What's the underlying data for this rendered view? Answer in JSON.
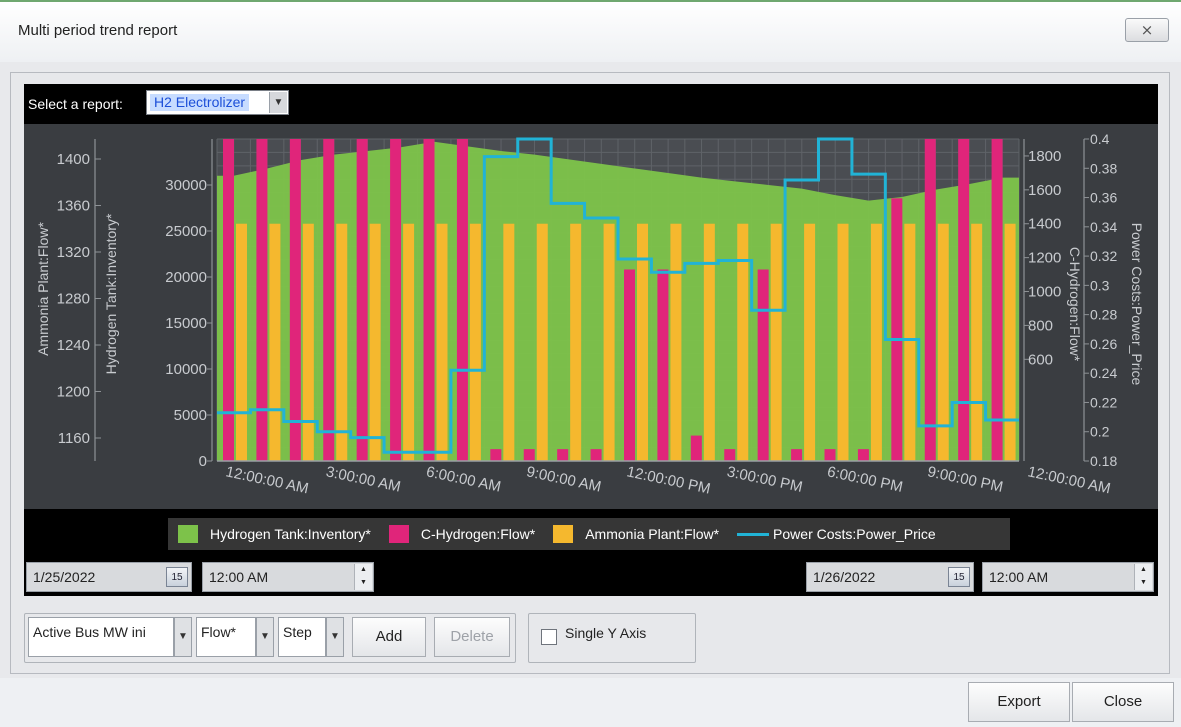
{
  "window": {
    "title": "Multi period trend report",
    "close_label": "⨯"
  },
  "report": {
    "select_label": "Select a report:",
    "selected": "H2 Electrolizer"
  },
  "chart_data": {
    "type": "bar",
    "x_ticks": [
      "12:00:00 AM",
      "3:00:00 AM",
      "6:00:00 AM",
      "9:00:00 AM",
      "12:00:00 PM",
      "3:00:00 PM",
      "6:00:00 PM",
      "9:00:00 PM",
      "12:00:00 AM"
    ],
    "slots": 24,
    "axes": {
      "ammonia": {
        "label": "Ammonia Plant:Flow*",
        "ticks": [
          1160,
          1200,
          1240,
          1280,
          1320,
          1360,
          1400
        ]
      },
      "hydrogen_tank": {
        "label": "Hydrogen Tank:Inventory*",
        "range": [
          0,
          35000
        ],
        "ticks": [
          0,
          5000,
          10000,
          15000,
          20000,
          25000,
          30000
        ]
      },
      "c_hydrogen": {
        "label": "C-Hydrogen:Flow*",
        "range": [
          0,
          1900
        ],
        "ticks": [
          600,
          800,
          1000,
          1200,
          1400,
          1600,
          1800
        ]
      },
      "power": {
        "label": "Power Costs:Power_Price",
        "range": [
          0.18,
          0.4
        ],
        "ticks": [
          0.18,
          0.2,
          0.22,
          0.24,
          0.26,
          0.28,
          0.3,
          0.32,
          0.34,
          0.36,
          0.38,
          0.4
        ]
      }
    },
    "series": [
      {
        "name": "Hydrogen Tank:Inventory*",
        "type": "area",
        "color": "#7dc24a",
        "values": [
          31000,
          31800,
          32700,
          33300,
          33700,
          34100,
          34700,
          34200,
          33700,
          33300,
          32800,
          32300,
          31800,
          31300,
          30800,
          30400,
          30000,
          29600,
          28900,
          28300,
          28700,
          29500,
          30100,
          30800
        ]
      },
      {
        "name": "C-Hydrogen:Flow*",
        "type": "bar",
        "color": "#e0257a",
        "values": [
          1900,
          1900,
          1900,
          1900,
          1900,
          1900,
          1900,
          1900,
          70,
          70,
          70,
          70,
          1130,
          1130,
          150,
          70,
          1130,
          70,
          70,
          70,
          1550,
          1900,
          1900,
          1900
        ]
      },
      {
        "name": "Ammonia Plant:Flow*",
        "type": "bar",
        "color": "#f5b82e",
        "values": [
          1400,
          1400,
          1400,
          1400,
          1400,
          1400,
          1400,
          1400,
          1400,
          1400,
          1400,
          1400,
          1400,
          1400,
          1400,
          1400,
          1400,
          1400,
          1400,
          1400,
          1400,
          1400,
          1400,
          1400
        ]
      },
      {
        "name": "Power Costs:Power_Price",
        "type": "line",
        "color": "#21b3d6",
        "values": [
          0.213,
          0.215,
          0.207,
          0.2,
          0.196,
          0.186,
          0.186,
          0.242,
          0.388,
          0.4,
          0.356,
          0.346,
          0.318,
          0.309,
          0.315,
          0.317,
          0.283,
          0.372,
          0.4,
          0.376,
          0.263,
          0.204,
          0.22,
          0.208
        ]
      }
    ]
  },
  "legend": [
    "Hydrogen Tank:Inventory*",
    "C-Hydrogen:Flow*",
    "Ammonia Plant:Flow*",
    "Power Costs:Power_Price"
  ],
  "range": {
    "start_date": "1/25/2022",
    "start_time": "12:00 AM",
    "end_date": "1/26/2022",
    "end_time": "12:00 AM",
    "cal_label": "15"
  },
  "controls": {
    "bus": "Active Bus MW ini",
    "measure": "Flow*",
    "mode": "Step",
    "add": "Add",
    "delete": "Delete",
    "single_axis": "Single Y Axis"
  },
  "footer": {
    "export": "Export",
    "close": "Close"
  },
  "colors": {
    "inventory": "#7dc24a",
    "c_hydrogen": "#e0257a",
    "ammonia": "#f5b82e",
    "power": "#21b3d6"
  }
}
